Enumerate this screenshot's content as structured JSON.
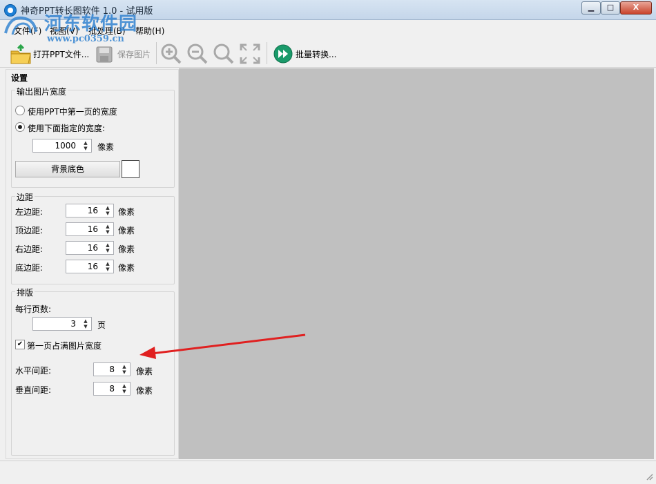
{
  "window": {
    "title": "神奇PPT转长图软件 1.0 - 试用版",
    "min_label": "▁",
    "max_label": "□",
    "close_label": "X"
  },
  "watermark": {
    "site_name": "河东软件园",
    "url": "www.pc0359.cn"
  },
  "menu": {
    "items": [
      "文件(F)",
      "视图(V)",
      "批处理(B)",
      "帮助(H)"
    ]
  },
  "toolbar": {
    "open": "打开PPT文件...",
    "save": "保存图片",
    "batch": "批量转换..."
  },
  "settings": {
    "title": "设置",
    "output_width": {
      "group_label": "输出图片宽度",
      "option_first_page": "使用PPT中第一页的宽度",
      "option_custom": "使用下面指定的宽度:",
      "selected": "option_custom",
      "width_value": "1000",
      "unit": "像素",
      "bg_button": "背景底色",
      "bg_color": "#ffffff"
    },
    "margins": {
      "group_label": "边距",
      "rows": [
        {
          "label": "左边距:",
          "value": "16",
          "unit": "像素"
        },
        {
          "label": "顶边距:",
          "value": "16",
          "unit": "像素"
        },
        {
          "label": "右边距:",
          "value": "16",
          "unit": "像素"
        },
        {
          "label": "底边距:",
          "value": "16",
          "unit": "像素"
        }
      ]
    },
    "layout": {
      "group_label": "排版",
      "pages_per_row_label": "每行页数:",
      "pages_per_row_value": "3",
      "pages_unit": "页",
      "first_page_full_label": "第一页占满图片宽度",
      "first_page_full_checked": true,
      "check_mark": "✔",
      "h_spacing_label": "水平间距:",
      "h_spacing_value": "8",
      "v_spacing_label": "垂直间距:",
      "v_spacing_value": "8",
      "unit": "像素"
    }
  },
  "colors": {
    "canvas_bg": "#c0c0c0",
    "annotation_arrow": "#e02020",
    "accent_green": "#1a9a6a"
  }
}
